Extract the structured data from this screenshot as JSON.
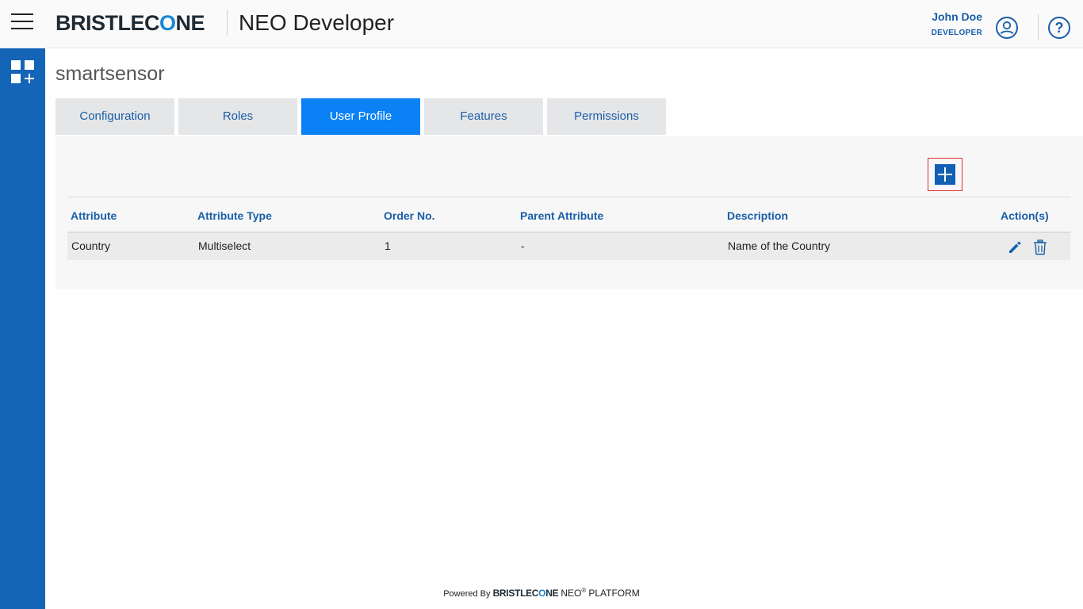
{
  "header": {
    "brand_prefix": "BRISTLEC",
    "brand_o": "O",
    "brand_suffix": "NE",
    "app_title": "NEO Developer",
    "user_name": "John Doe",
    "user_role": "DEVELOPER",
    "help_glyph": "?"
  },
  "sidebar": {
    "icon": "apps-add-icon"
  },
  "main": {
    "page_title": "smartsensor",
    "tabs": [
      {
        "label": "Configuration",
        "active": false
      },
      {
        "label": "Roles",
        "active": false
      },
      {
        "label": "User Profile",
        "active": true
      },
      {
        "label": "Features",
        "active": false
      },
      {
        "label": "Permissions",
        "active": false
      }
    ],
    "table": {
      "headers": [
        "Attribute",
        "Attribute Type",
        "Order No.",
        "Parent Attribute",
        "Description",
        "Action(s)"
      ],
      "rows": [
        {
          "attribute": "Country",
          "attribute_type": "Multiselect",
          "order_no": "1",
          "parent_attribute": "-",
          "description": "Name of the Country"
        }
      ]
    }
  },
  "footer": {
    "powered_by": "Powered By",
    "brand_prefix": "BRISTLEC",
    "brand_o": "O",
    "brand_suffix": "NE",
    "neo": "NEO",
    "registered": "®",
    "platform": "PLATFORM"
  },
  "colors": {
    "primary": "#1465b8",
    "active_tab": "#0a82f5",
    "link_text": "#1a5ea8"
  }
}
